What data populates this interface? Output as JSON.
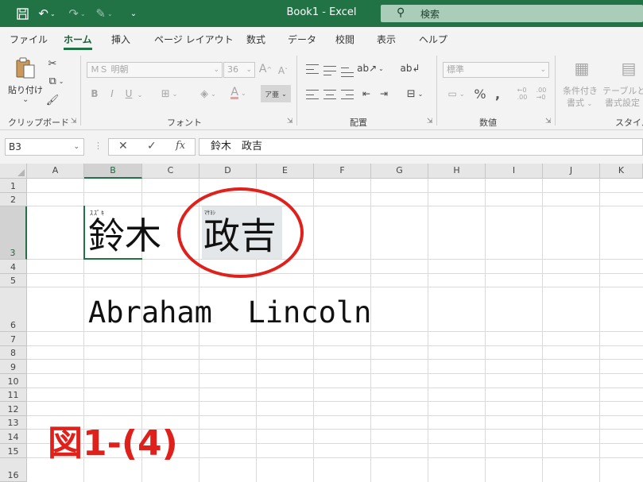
{
  "title_bar": {
    "doc_title": "Book1  -  Excel",
    "search_placeholder": "検索"
  },
  "tabs": [
    "ファイル",
    "ホーム",
    "挿入",
    "ページ レイアウト",
    "数式",
    "データ",
    "校閲",
    "表示",
    "ヘルプ"
  ],
  "active_tab": "ホーム",
  "ribbon": {
    "clipboard": {
      "label": "クリップボード",
      "paste_line1": "貼り付け",
      "paste_line2": "け"
    },
    "font": {
      "label": "フォント",
      "font_name": "ＭＳ 明朝",
      "font_size": "36",
      "bold": "B",
      "italic": "I",
      "underline": "U",
      "grow": "A",
      "shrink": "A",
      "font_color": "A"
    },
    "alignment": {
      "label": "配置"
    },
    "number": {
      "label": "数値",
      "format": "標準",
      "percent": "%"
    },
    "styles": {
      "label": "スタイル",
      "cond_format_line1": "条件付き",
      "cond_format_line2": "書式",
      "table_line1": "テーブルとし",
      "table_line2": "書式設定"
    }
  },
  "formula_bar": {
    "name_box": "B3",
    "dots": "⋮",
    "cancel": "✕",
    "enter": "✓",
    "fx": "fx",
    "formula": "鈴木　政吉"
  },
  "grid": {
    "columns": [
      "A",
      "B",
      "C",
      "D",
      "E",
      "F",
      "G",
      "H",
      "I",
      "J",
      "K"
    ],
    "rows": [
      "1",
      "2",
      "3",
      "4",
      "5",
      "6",
      "7",
      "8",
      "9",
      "10",
      "11",
      "12",
      "13",
      "14",
      "15",
      "16"
    ],
    "selected_column": "B",
    "selected_row": "3"
  },
  "cells": {
    "b3_phonetic": "ｽｽﾞｷ",
    "d3_phonetic": "ﾏｻﾖｼ",
    "b3_surname": "鈴木",
    "d3_given": "政吉",
    "b6_text": "Abraham  Lincoln"
  },
  "annotation": {
    "figure_label": "図1-(4)",
    "circle_color": "#e0201a"
  },
  "colors": {
    "excel_green": "#217346",
    "ribbon_bg": "#f3f3f3"
  }
}
